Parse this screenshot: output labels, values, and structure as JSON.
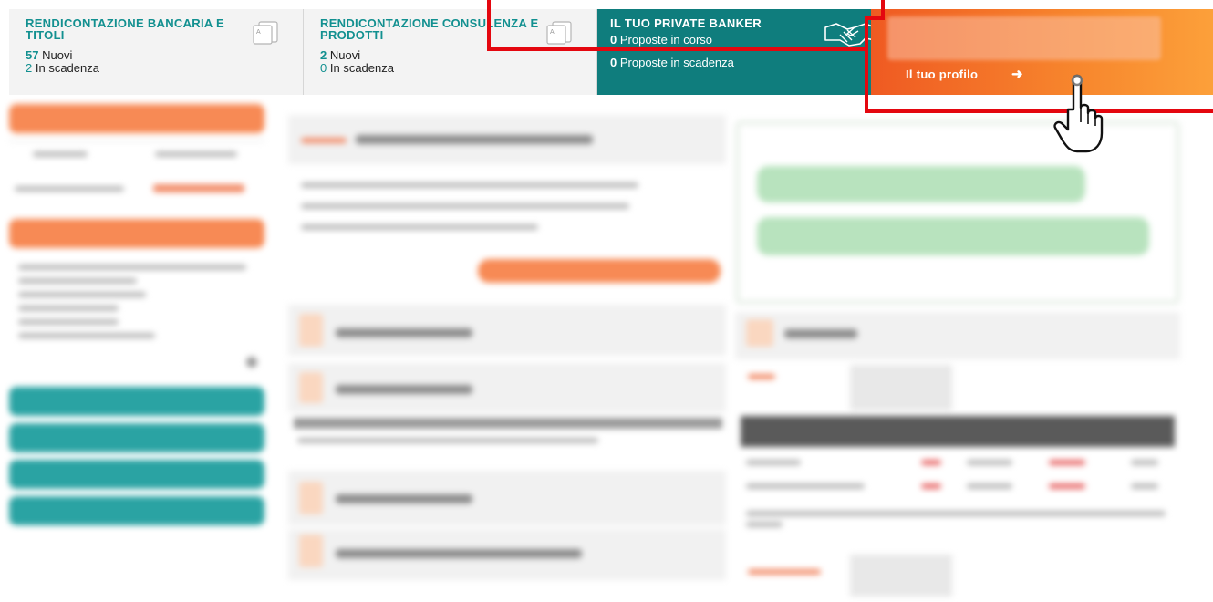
{
  "topbar": {
    "tile1": {
      "title": "RENDICONTAZIONE BANCARIA E TITOLI",
      "new_count": "57",
      "new_label": "Nuovi",
      "expiring_count": "2",
      "expiring_label": "In scadenza"
    },
    "tile2": {
      "title": "RENDICONTAZIONE CONSULENZA E PRODOTTI",
      "new_count": "2",
      "new_label": "Nuovi",
      "expiring_count": "0",
      "expiring_label": "In scadenza"
    },
    "tile3": {
      "title": "IL TUO PRIVATE BANKER",
      "proposals_count": "0",
      "proposals_label": "Proposte in corso",
      "expiring_count": "0",
      "expiring_label": "Proposte in scadenza"
    },
    "tile4": {
      "profile_label": "Il tuo profilo",
      "arrow": "➜"
    }
  },
  "colors": {
    "teal": "#129090",
    "banker_bg": "#0f7d7d",
    "profile_gradient_start": "#ef5a22",
    "profile_gradient_end": "#fca03a",
    "highlight_red": "#e4070f",
    "slogan_green": "#8fd39a"
  },
  "icons": [
    "document-icon",
    "handshake-icon",
    "arrow-right-icon",
    "hand-pointer-cursor"
  ]
}
